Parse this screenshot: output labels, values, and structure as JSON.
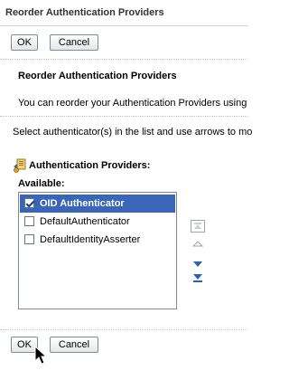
{
  "dialog": {
    "title": "Reorder Authentication Providers"
  },
  "toolbar_top": {
    "ok_label": "OK",
    "cancel_label": "Cancel"
  },
  "section": {
    "heading": "Reorder Authentication Providers",
    "description": "You can reorder your Authentication Providers using",
    "instruction": "Select authenticator(s) in the list and use arrows to mo"
  },
  "providers": {
    "title": "Authentication Providers:",
    "available_label": "Available:",
    "items": [
      {
        "label": "OID Authenticator",
        "checked": true,
        "selected": true
      },
      {
        "label": "DefaultAuthenticator",
        "checked": false,
        "selected": false
      },
      {
        "label": "DefaultIdentityAsserter",
        "checked": false,
        "selected": false
      }
    ]
  },
  "reorder_buttons": [
    "move-to-top-icon",
    "move-up-icon",
    "move-down-icon",
    "move-to-bottom-icon"
  ],
  "toolbar_bottom": {
    "ok_label": "OK",
    "cancel_label": "Cancel"
  },
  "colors": {
    "selection": "#3a66b9",
    "arrow": "#2a61b8",
    "border": "#7f8b95"
  }
}
